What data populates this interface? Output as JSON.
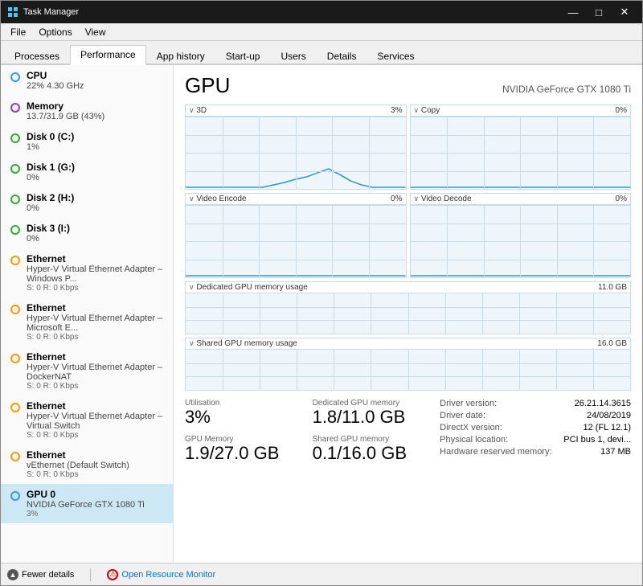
{
  "window": {
    "title": "Task Manager",
    "controls": {
      "minimize": "—",
      "maximize": "□",
      "close": "✕"
    }
  },
  "menubar": {
    "items": [
      "File",
      "Options",
      "View"
    ]
  },
  "tabs": {
    "items": [
      "Processes",
      "Performance",
      "App history",
      "Start-up",
      "Users",
      "Details",
      "Services"
    ],
    "active": "Performance"
  },
  "sidebar": {
    "items": [
      {
        "id": "cpu",
        "dot": "blue",
        "title": "CPU",
        "line1": "22%  4.30 GHz"
      },
      {
        "id": "memory",
        "dot": "purple",
        "title": "Memory",
        "line1": "13.7/31.9 GB (43%)"
      },
      {
        "id": "disk0",
        "dot": "green",
        "title": "Disk 0 (C:)",
        "line1": "1%"
      },
      {
        "id": "disk1",
        "dot": "green",
        "title": "Disk 1 (G:)",
        "line1": "0%"
      },
      {
        "id": "disk2",
        "dot": "green",
        "title": "Disk 2 (H:)",
        "line1": "0%"
      },
      {
        "id": "disk3",
        "dot": "green",
        "title": "Disk 3 (I:)",
        "line1": "0%"
      },
      {
        "id": "eth0",
        "dot": "orange",
        "title": "Ethernet",
        "line1": "Hyper-V Virtual Ethernet Adapter – Windows P...",
        "line2": "S: 0 R: 0 Kbps"
      },
      {
        "id": "eth1",
        "dot": "orange",
        "title": "Ethernet",
        "line1": "Hyper-V Virtual Ethernet Adapter – Microsoft E...",
        "line2": "S: 0 R: 0 Kbps"
      },
      {
        "id": "eth2",
        "dot": "orange",
        "title": "Ethernet",
        "line1": "Hyper-V Virtual Ethernet Adapter – DockerNAT",
        "line2": "S: 0 R: 0 Kbps"
      },
      {
        "id": "eth3",
        "dot": "orange",
        "title": "Ethernet",
        "line1": "Hyper-V Virtual Ethernet Adapter – Virtual Switch",
        "line2": "S: 0 R: 0 Kbps"
      },
      {
        "id": "eth4",
        "dot": "orange",
        "title": "Ethernet",
        "line1": "vEthernet (Default Switch)",
        "line2": "S: 0 R: 0 Kbps"
      },
      {
        "id": "gpu0",
        "dot": "blue",
        "title": "GPU 0",
        "line1": "NVIDIA GeForce GTX 1080 Ti",
        "line2": "3%",
        "active": true
      }
    ]
  },
  "detail": {
    "gpu_title": "GPU",
    "gpu_name": "NVIDIA GeForce GTX 1080 Ti",
    "charts": [
      {
        "label": "3D",
        "value": "3%",
        "has_spike": true
      },
      {
        "label": "Copy",
        "value": "0%",
        "has_spike": false
      },
      {
        "label": "Video Encode",
        "value": "0%",
        "has_spike": false
      },
      {
        "label": "Video Decode",
        "value": "0%",
        "has_spike": false
      }
    ],
    "memory_charts": [
      {
        "label": "Dedicated GPU memory usage",
        "value": "11.0 GB"
      },
      {
        "label": "Shared GPU memory usage",
        "value": "16.0 GB"
      }
    ],
    "stats": [
      {
        "label": "Utilisation",
        "value": "3%"
      },
      {
        "label": "GPU Memory",
        "value": "1.9/27.0 GB"
      }
    ],
    "stats2": [
      {
        "label": "Dedicated GPU memory",
        "value": "1.8/11.0 GB"
      },
      {
        "label": "Shared GPU memory",
        "value": "0.1/16.0 GB"
      }
    ],
    "info": [
      {
        "label": "Driver version:",
        "value": "26.21.14.3615"
      },
      {
        "label": "Driver date:",
        "value": "24/08/2019"
      },
      {
        "label": "DirectX version:",
        "value": "12 (FL 12.1)"
      },
      {
        "label": "Physical location:",
        "value": "PCI bus 1, devi..."
      },
      {
        "label": "Hardware reserved memory:",
        "value": "137 MB"
      }
    ]
  },
  "footer": {
    "fewer_details": "Fewer details",
    "open_monitor": "Open Resource Monitor"
  }
}
